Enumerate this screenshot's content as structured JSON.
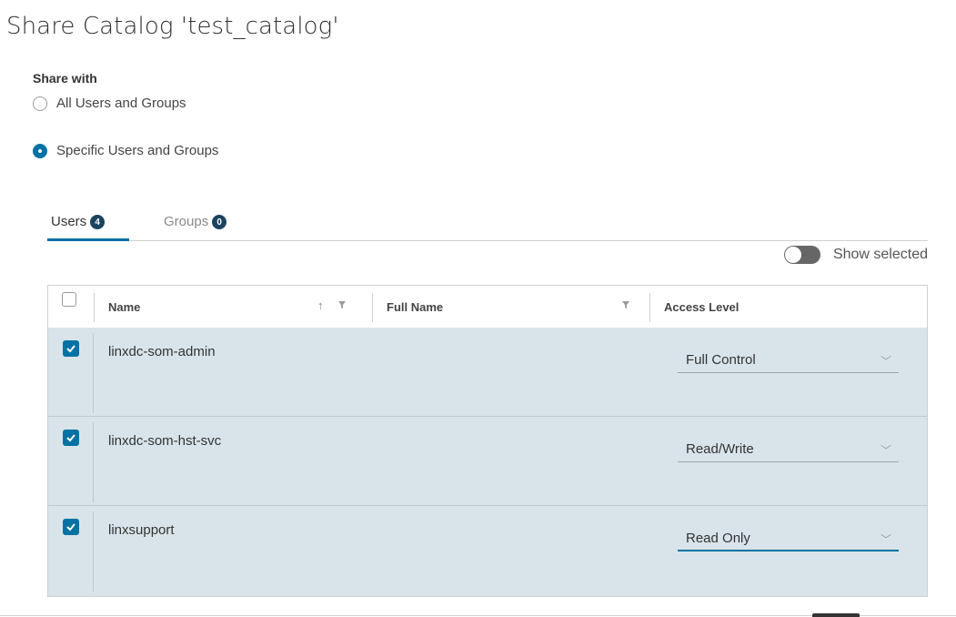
{
  "dialog": {
    "title": "Share Catalog 'test_catalog'"
  },
  "share_with": {
    "label": "Share with",
    "options": [
      {
        "label": "All Users and Groups",
        "selected": false
      },
      {
        "label": "Specific Users and Groups",
        "selected": true
      }
    ]
  },
  "tabs": [
    {
      "label": "Users",
      "count": "4",
      "active": true
    },
    {
      "label": "Groups",
      "count": "0",
      "active": false
    }
  ],
  "show_selected": {
    "label": "Show selected",
    "on": false
  },
  "table": {
    "columns": [
      "Name",
      "Full Name",
      "Access Level"
    ],
    "rows": [
      {
        "name": "linxdc-som-admin",
        "full_name": "",
        "access": "Full Control",
        "checked": true
      },
      {
        "name": "linxdc-som-hst-svc",
        "full_name": "",
        "access": "Read/Write",
        "checked": true
      },
      {
        "name": "linxsupport",
        "full_name": "",
        "access": "Read Only",
        "checked": true
      }
    ]
  },
  "colors": {
    "accent": "#0072a3",
    "row_selected": "#d9e4ea",
    "badge": "#1b4360"
  }
}
